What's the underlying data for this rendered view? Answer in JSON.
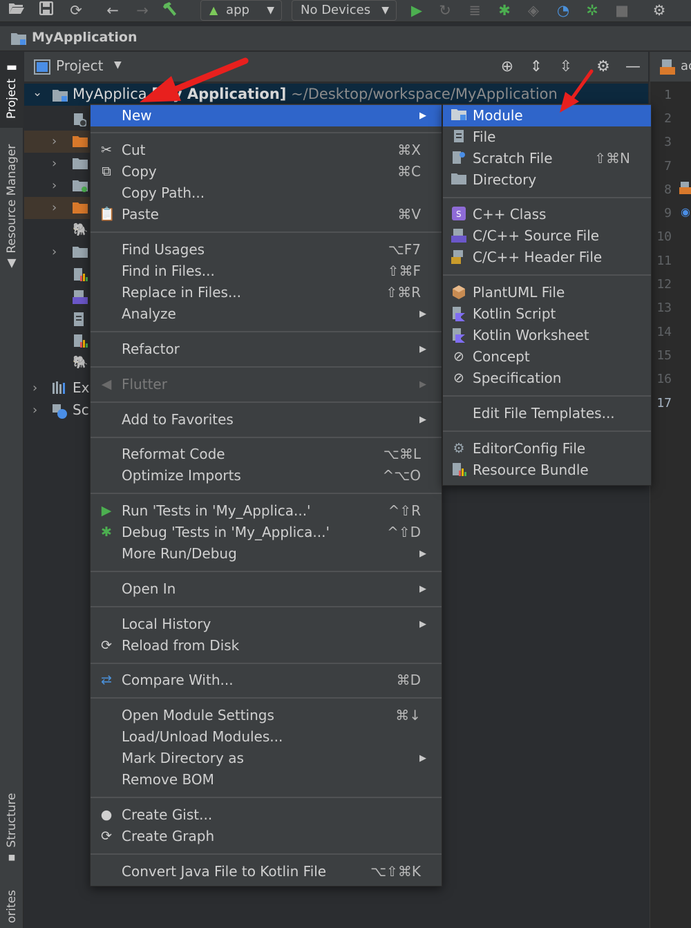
{
  "toolbar": {
    "icons": [
      "open-folder-icon",
      "save-icon",
      "sync-icon",
      "back-arrow-icon",
      "forward-arrow-icon",
      "build-hammer-icon",
      "run-icon",
      "apply-changes-icon",
      "apply-code-changes-icon",
      "debug-icon",
      "profile-icon",
      "coverage-icon",
      "attach-debugger-icon",
      "stop-icon",
      "device-manager-icon"
    ],
    "run_config": "app",
    "device": "No Devices"
  },
  "navbar": {
    "title": "MyApplication"
  },
  "tool_windows": {
    "project": "Project",
    "resource_manager": "Resource Manager",
    "structure": "Structure",
    "favorites": "orites"
  },
  "project_panel": {
    "view_mode": "Project"
  },
  "tree": {
    "root_name": "MyApplica",
    "root_module": "[My Application]",
    "root_path": "~/Desktop/workspace/MyApplication",
    "ext_libs_label": "Ex",
    "scratches_label": "Sc"
  },
  "editor": {
    "tab_label": "ac",
    "line_numbers": [
      "1",
      "2",
      "3",
      "7",
      "8",
      "9",
      "10",
      "11",
      "12",
      "13",
      "14",
      "15",
      "16",
      "17"
    ]
  },
  "context_menu": {
    "new": "New",
    "cut": "Cut",
    "cut_sc": "⌘X",
    "copy": "Copy",
    "copy_sc": "⌘C",
    "copy_path": "Copy Path...",
    "paste": "Paste",
    "paste_sc": "⌘V",
    "find_usages": "Find Usages",
    "find_usages_sc": "⌥F7",
    "find_in_files": "Find in Files...",
    "find_in_files_sc": "⇧⌘F",
    "replace_in_files": "Replace in Files...",
    "replace_in_files_sc": "⇧⌘R",
    "analyze": "Analyze",
    "refactor": "Refactor",
    "flutter": "Flutter",
    "add_to_favorites": "Add to Favorites",
    "reformat_code": "Reformat Code",
    "reformat_code_sc": "⌥⌘L",
    "optimize_imports": "Optimize Imports",
    "optimize_imports_sc": "^⌥O",
    "run_tests": "Run 'Tests in 'My_Applica...'",
    "run_tests_sc": "^⇧R",
    "debug_tests": "Debug 'Tests in 'My_Applica...'",
    "debug_tests_sc": "^⇧D",
    "more_run_debug": "More Run/Debug",
    "open_in": "Open In",
    "local_history": "Local History",
    "reload_from_disk": "Reload from Disk",
    "compare_with": "Compare With...",
    "compare_with_sc": "⌘D",
    "open_module_settings": "Open Module Settings",
    "open_module_settings_sc": "⌘↓",
    "load_unload_modules": "Load/Unload Modules...",
    "mark_directory_as": "Mark Directory as",
    "remove_bom": "Remove BOM",
    "create_gist": "Create Gist...",
    "create_graph": "Create Graph",
    "convert_java_to_kotlin": "Convert Java File to Kotlin File",
    "convert_java_to_kotlin_sc": "⌥⇧⌘K"
  },
  "submenu_new": {
    "module": "Module",
    "file": "File",
    "scratch_file": "Scratch File",
    "scratch_file_sc": "⇧⌘N",
    "directory": "Directory",
    "cpp_class": "C++ Class",
    "cpp_source": "C/C++ Source File",
    "cpp_header": "C/C++ Header File",
    "plantuml": "PlantUML File",
    "kotlin_script": "Kotlin Script",
    "kotlin_worksheet": "Kotlin Worksheet",
    "concept": "Concept",
    "specification": "Specification",
    "edit_templates": "Edit File Templates...",
    "editorconfig": "EditorConfig File",
    "resource_bundle": "Resource Bundle"
  },
  "colors": {
    "selection": "#2f65ca",
    "menu_bg": "#3c3f41",
    "annotation_arrow": "#e8201e",
    "run_green": "#4caf50"
  }
}
